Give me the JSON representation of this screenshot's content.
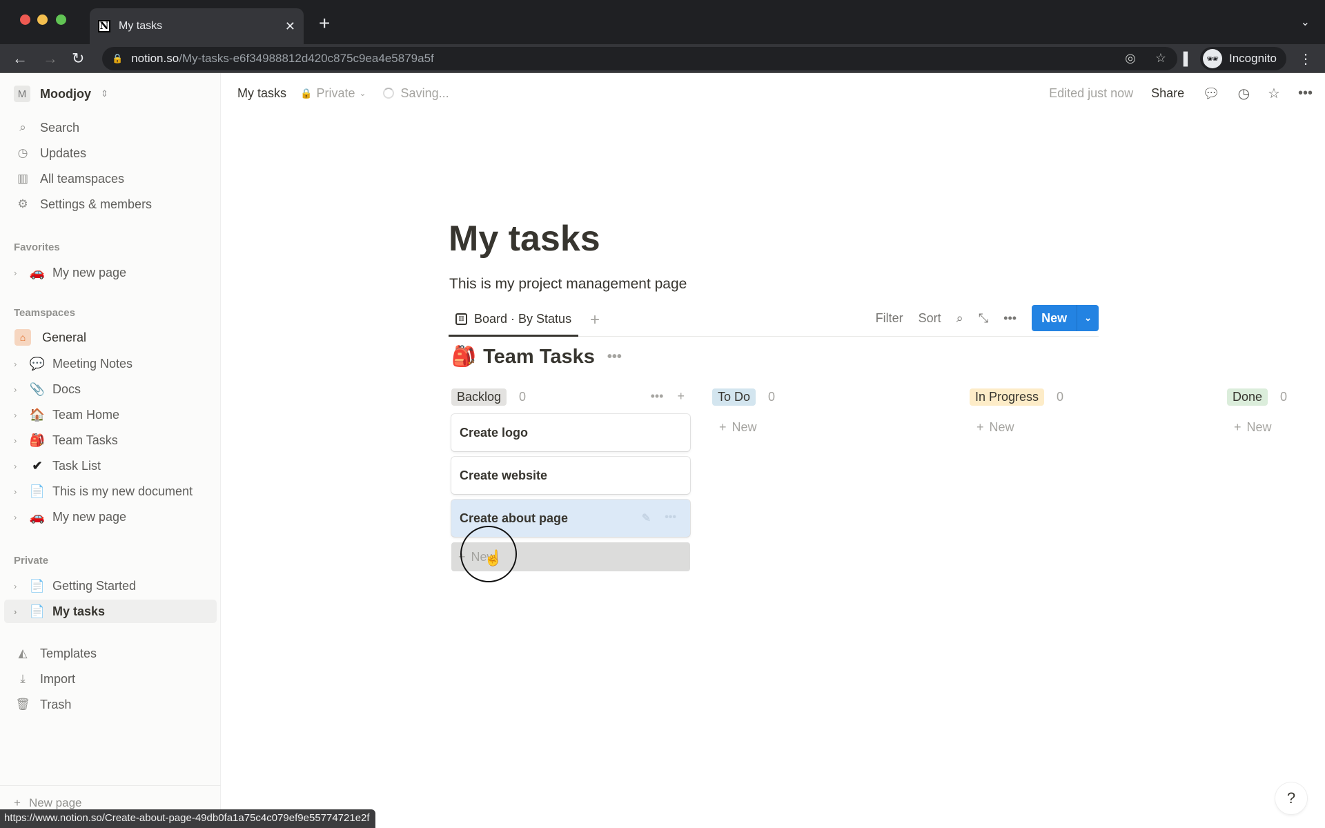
{
  "browser": {
    "tab_title": "My tasks",
    "tab_favicon": "N",
    "url_host": "notion.so",
    "url_path": "/My-tasks-e6f34988812d420c875c9ea4e5879a5f",
    "profile_label": "Incognito",
    "status_url": "https://www.notion.so/Create-about-page-49db0fa1a75c4c079ef9e55774721e2f"
  },
  "sidebar": {
    "workspace_initial": "M",
    "workspace_name": "Moodjoy",
    "nav": [
      {
        "label": "Search",
        "icon": "search-icon"
      },
      {
        "label": "Updates",
        "icon": "clock-icon"
      },
      {
        "label": "All teamspaces",
        "icon": "building-icon"
      },
      {
        "label": "Settings & members",
        "icon": "gear-icon"
      }
    ],
    "favorites_label": "Favorites",
    "favorites": [
      {
        "label": "My new page",
        "emoji": "🚗"
      }
    ],
    "teamspaces_label": "Teamspaces",
    "teamspace_name": "General",
    "teamspace_items": [
      {
        "label": "Meeting Notes",
        "emoji": "💬"
      },
      {
        "label": "Docs",
        "emoji": "📎"
      },
      {
        "label": "Team Home",
        "emoji": "🏠"
      },
      {
        "label": "Team Tasks",
        "emoji": "🎒"
      },
      {
        "label": "Task List",
        "emoji": "✔"
      },
      {
        "label": "This is my new document",
        "emoji": "📄"
      },
      {
        "label": "My new page",
        "emoji": "🚗"
      }
    ],
    "private_label": "Private",
    "private_items": [
      {
        "label": "Getting Started",
        "emoji": "📄"
      },
      {
        "label": "My tasks",
        "emoji": "📄",
        "active": true
      }
    ],
    "bottom": [
      {
        "label": "Templates",
        "icon": "templates-icon"
      },
      {
        "label": "Import",
        "icon": "import-icon"
      },
      {
        "label": "Trash",
        "icon": "trash-icon"
      }
    ],
    "new_page_label": "New page"
  },
  "topbar": {
    "breadcrumb": "My tasks",
    "privacy": "Private",
    "saving": "Saving...",
    "edited": "Edited just now",
    "share": "Share"
  },
  "page": {
    "title": "My tasks",
    "description": "This is my project management page",
    "view_tab": "Board · By Status",
    "tools": {
      "filter": "Filter",
      "sort": "Sort",
      "new": "New"
    },
    "database_title": "Team Tasks",
    "database_emoji": "🎒"
  },
  "board": {
    "new_label": "New",
    "columns": [
      {
        "status": "Backlog",
        "count": "0",
        "color": "#e3e2e0",
        "cards": [
          "Create logo",
          "Create website",
          "Create about page"
        ]
      },
      {
        "status": "To Do",
        "count": "0",
        "color": "#d3e5ef",
        "cards": []
      },
      {
        "status": "In Progress",
        "count": "0",
        "color": "#fdecc8",
        "cards": []
      },
      {
        "status": "Done",
        "count": "0",
        "color": "#dbeddb",
        "cards": []
      }
    ]
  },
  "help_label": "?"
}
